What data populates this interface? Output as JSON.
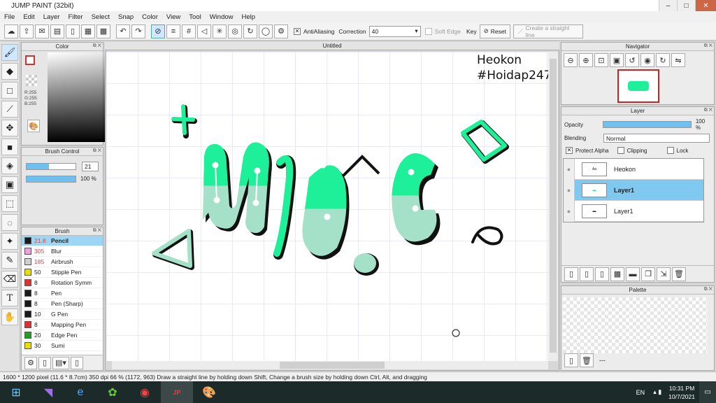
{
  "window": {
    "title": "JUMP PAINT (32bit)"
  },
  "menu": [
    "File",
    "Edit",
    "Layer",
    "Filter",
    "Select",
    "Snap",
    "Color",
    "View",
    "Tool",
    "Window",
    "Help"
  ],
  "toolbar": {
    "antialiasing_label": "AntiAliasing",
    "correction_label": "Correction",
    "correction_value": "40",
    "soft_edge_label": "Soft Edge",
    "key_label": "Key",
    "reset_label": "Reset",
    "straight_line_label": "Create a straight line"
  },
  "color_panel": {
    "title": "Color",
    "r": "R:255",
    "g": "G:255",
    "b": "B:255"
  },
  "brush_control": {
    "title": "Brush Control",
    "size": "21",
    "opacity": "100 %"
  },
  "brush_panel": {
    "title": "Brush",
    "items": [
      {
        "size": "21.8",
        "name": "Pencil",
        "color": "#1a1a1a"
      },
      {
        "size": "305",
        "name": "Blur",
        "color": "#f0a0e0"
      },
      {
        "size": "185",
        "name": "Airbrush",
        "color": "#d0d0d0"
      },
      {
        "size": "50",
        "name": "Stipple Pen",
        "color": "#e8e000"
      },
      {
        "size": "8",
        "name": "Rotation Symm",
        "color": "#e03030"
      },
      {
        "size": "8",
        "name": "Pen",
        "color": "#1a1a1a"
      },
      {
        "size": "8",
        "name": "Pen (Sharp)",
        "color": "#1a1a1a"
      },
      {
        "size": "10",
        "name": "G Pen",
        "color": "#1a1a1a"
      },
      {
        "size": "8",
        "name": "Mapping Pen",
        "color": "#e03030"
      },
      {
        "size": "20",
        "name": "Edge Pen",
        "color": "#20a020"
      },
      {
        "size": "30",
        "name": "Sumi",
        "color": "#e8e000"
      }
    ]
  },
  "canvas": {
    "title": "Untitled",
    "text_line1": "Heokon",
    "text_line2": "#Hoidap247"
  },
  "navigator": {
    "title": "Navigator"
  },
  "layer_panel": {
    "title": "Layer",
    "opacity_label": "Opacity",
    "opacity_value": "100 %",
    "blending_label": "Blending",
    "blending_value": "Normal",
    "protect_alpha": "Protect Alpha",
    "clipping": "Clipping",
    "lock": "Lock",
    "layers": [
      {
        "name": "Heokon"
      },
      {
        "name": "Layer1"
      },
      {
        "name": "Layer1"
      }
    ]
  },
  "palette": {
    "title": "Palette",
    "dash": "---"
  },
  "status": {
    "text": "1600 * 1200 pixel  (11.6 * 8.7cm)  350 dpi  66 %  (1172, 963)  Draw a straight line by holding down Shift, Change a brush size by holding down Ctrl, Alt, and dragging"
  },
  "taskbar": {
    "lang": "EN",
    "time": "10:31 PM",
    "date": "10/7/2021"
  },
  "colors": {
    "accent_green": "#1ef09a",
    "light_green": "#a5e0c8"
  }
}
